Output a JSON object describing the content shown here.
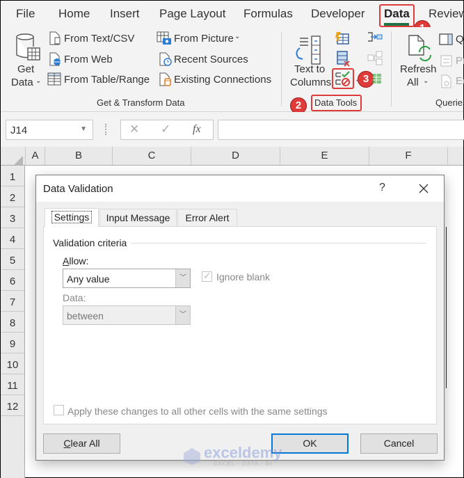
{
  "ribbon_tabs": [
    {
      "label": "File",
      "active": false
    },
    {
      "label": "Home",
      "active": false
    },
    {
      "label": "Insert",
      "active": false
    },
    {
      "label": "Page Layout",
      "active": false
    },
    {
      "label": "Formulas",
      "active": false
    },
    {
      "label": "Developer",
      "active": false
    },
    {
      "label": "Data",
      "active": true
    },
    {
      "label": "Review",
      "active": false
    }
  ],
  "ribbon": {
    "get_transform": {
      "get_data_line1": "Get",
      "get_data_line2": "Data",
      "items_col1": [
        "From Text/CSV",
        "From Web",
        "From Table/Range"
      ],
      "items_col2": [
        "From Picture",
        "Recent Sources",
        "Existing Connections"
      ],
      "group_label": "Get & Transform Data"
    },
    "data_tools": {
      "text_to_columns_line1": "Text to",
      "text_to_columns_line2": "Columns",
      "group_label": "Data Tools"
    },
    "queries": {
      "refresh_line1": "Refresh",
      "refresh_line2": "All",
      "side_items": [
        "Q",
        "Pr",
        "Ec"
      ],
      "group_label": "Queries"
    }
  },
  "annotations": {
    "badges": [
      "1",
      "2",
      "3"
    ],
    "color": "#e03b3b"
  },
  "formula_bar": {
    "name_box": "J14",
    "cancel_glyph": "✕",
    "enter_glyph": "✓",
    "fx_label": "fx",
    "formula": ""
  },
  "grid": {
    "columns": [
      "A",
      "B",
      "C",
      "D",
      "E",
      "F"
    ],
    "rows": [
      "1",
      "2",
      "3",
      "4",
      "5",
      "6",
      "7",
      "8",
      "9",
      "10",
      "11",
      "12"
    ]
  },
  "dialog": {
    "title": "Data Validation",
    "help": "?",
    "tabs": [
      {
        "label": "Settings",
        "active": true
      },
      {
        "label": "Input Message",
        "active": false
      },
      {
        "label": "Error Alert",
        "active": false
      }
    ],
    "group_label": "Validation criteria",
    "allow_label_accel": "A",
    "allow_label_rest": "llow:",
    "allow_value": "Any value",
    "ignore_blank_label": "Ignore blank",
    "ignore_blank_checked": true,
    "data_label": "Data:",
    "data_value": "between",
    "apply_label": "Apply these changes to all other cells with the same settings",
    "apply_checked": false,
    "clear_all_accel": "C",
    "clear_all_rest": "lear All",
    "ok_label": "OK",
    "cancel_label": "Cancel"
  },
  "watermark": {
    "text": "exceldemy",
    "sub": "EXCEL · DATA · BI"
  }
}
